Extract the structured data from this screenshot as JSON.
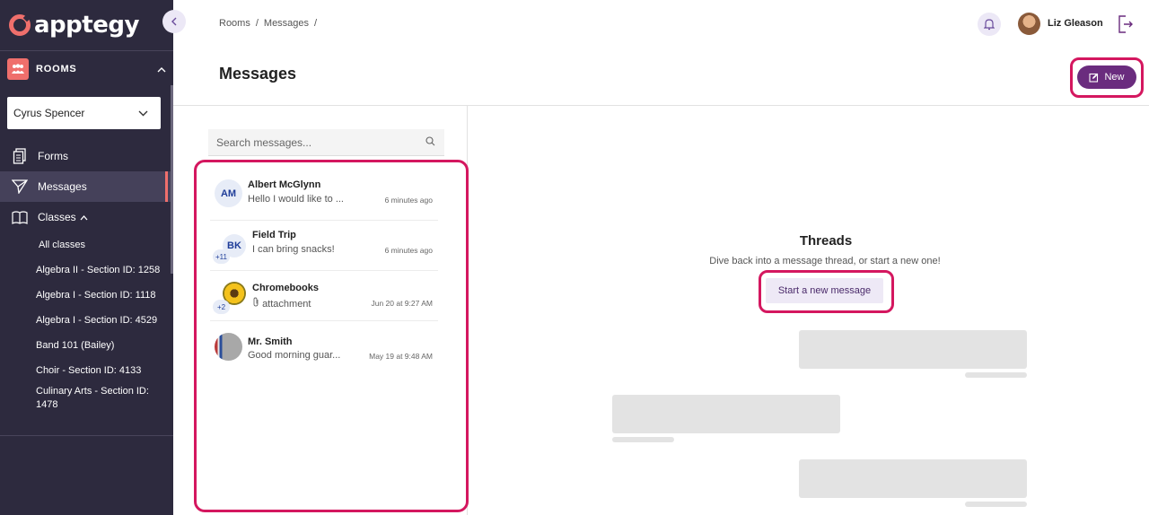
{
  "brand": {
    "name": "apptegy"
  },
  "sidebar": {
    "section_label": "ROOMS",
    "room_select": {
      "value": "Cyrus Spencer"
    },
    "nav": [
      {
        "label": "Forms"
      },
      {
        "label": "Messages"
      },
      {
        "label": "Classes"
      }
    ],
    "classes": [
      "All classes",
      "Algebra II - Section ID: 1258",
      "Algebra I - Section ID: 1118",
      "Algebra I - Section ID: 4529",
      "Band 101 (Bailey)",
      "Choir - Section ID: 4133",
      "Culinary Arts - Section ID: 1478"
    ]
  },
  "header": {
    "breadcrumb": [
      "Rooms",
      "/",
      "Messages",
      "/"
    ],
    "user_name": "Liz Gleason",
    "page_title": "Messages",
    "new_label": "New"
  },
  "search": {
    "placeholder": "Search messages..."
  },
  "threads": [
    {
      "initials": "AM",
      "name": "Albert McGlynn",
      "preview": "Hello I would like to ...",
      "time": "6 minutes ago"
    },
    {
      "initials": "BK",
      "badge": "+11",
      "name": "Field Trip",
      "preview": "I can bring snacks!",
      "time": "6 minutes ago"
    },
    {
      "badge": "+2",
      "name": "Chromebooks",
      "preview": "attachment",
      "time": "Jun 20 at 9:27 AM"
    },
    {
      "name": "Mr. Smith",
      "preview": "Good morning guar...",
      "time": "May 19 at 9:48 AM"
    }
  ],
  "empty_state": {
    "title": "Threads",
    "subtitle": "Dive back into a message thread, or start a new one!",
    "button_label": "Start a new message"
  },
  "colors": {
    "accent": "#6a2c7e",
    "highlight": "#d4175f",
    "sidebar": "#2d2a3e",
    "brand": "#ef6f6c"
  }
}
